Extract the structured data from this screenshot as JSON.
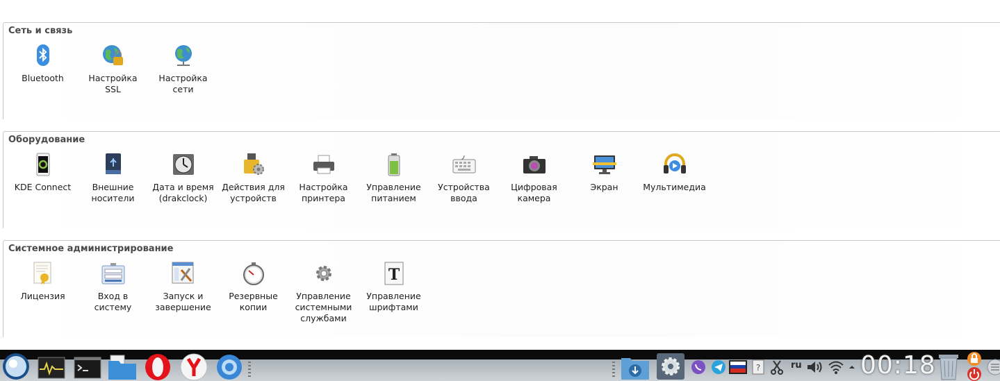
{
  "sections": [
    {
      "title": "Сеть и связь",
      "items": [
        {
          "label": "Bluetooth",
          "icon": "bluetooth-icon"
        },
        {
          "label": "Настройка\nSSL",
          "icon": "ssl-globe-lock-icon"
        },
        {
          "label": "Настройка\nсети",
          "icon": "network-globe-icon"
        }
      ]
    },
    {
      "title": "Оборудование",
      "items": [
        {
          "label": "KDE Connect",
          "icon": "phone-icon"
        },
        {
          "label": "Внешние\nносители",
          "icon": "usb-drive-icon"
        },
        {
          "label": "Дата и время\n(drakclock)",
          "icon": "clock-icon"
        },
        {
          "label": "Действия для\nустройств",
          "icon": "device-actions-icon"
        },
        {
          "label": "Настройка\nпринтера",
          "icon": "printer-icon"
        },
        {
          "label": "Управление\nпитанием",
          "icon": "battery-icon"
        },
        {
          "label": "Устройства\nввода",
          "icon": "keyboard-icon"
        },
        {
          "label": "Цифровая\nкамера",
          "icon": "camera-icon"
        },
        {
          "label": "Экран",
          "icon": "monitor-icon"
        },
        {
          "label": "Мультимедиа",
          "icon": "headphones-icon"
        }
      ]
    },
    {
      "title": "Системное администрирование",
      "items": [
        {
          "label": "Лицензия",
          "icon": "certificate-icon"
        },
        {
          "label": "Вход в\nсистему",
          "icon": "login-icon"
        },
        {
          "label": "Запуск и\nзавершение",
          "icon": "startup-window-icon"
        },
        {
          "label": "Резервные\nкопии",
          "icon": "backup-stopwatch-icon"
        },
        {
          "label": "Управление\nсистемными\nслужбами",
          "icon": "gear-icon"
        },
        {
          "label": "Управление\nшрифтами",
          "icon": "font-icon"
        }
      ]
    }
  ],
  "taskbar": {
    "clock": "00:18",
    "language": "ru",
    "apps": [
      "start-menu-icon",
      "system-monitor-icon",
      "terminal-icon",
      "file-manager-icon",
      "opera-icon",
      "yandex-browser-icon",
      "browser-icon"
    ],
    "tray": [
      "downloads-icon",
      "settings-center-icon",
      "viber-icon",
      "telegram-icon",
      "russian-flag-icon",
      "help-icon",
      "scissors-icon",
      "volume-icon",
      "wifi-icon",
      "arrow-up-icon",
      "trash-icon",
      "lock-icon",
      "power-icon"
    ]
  }
}
